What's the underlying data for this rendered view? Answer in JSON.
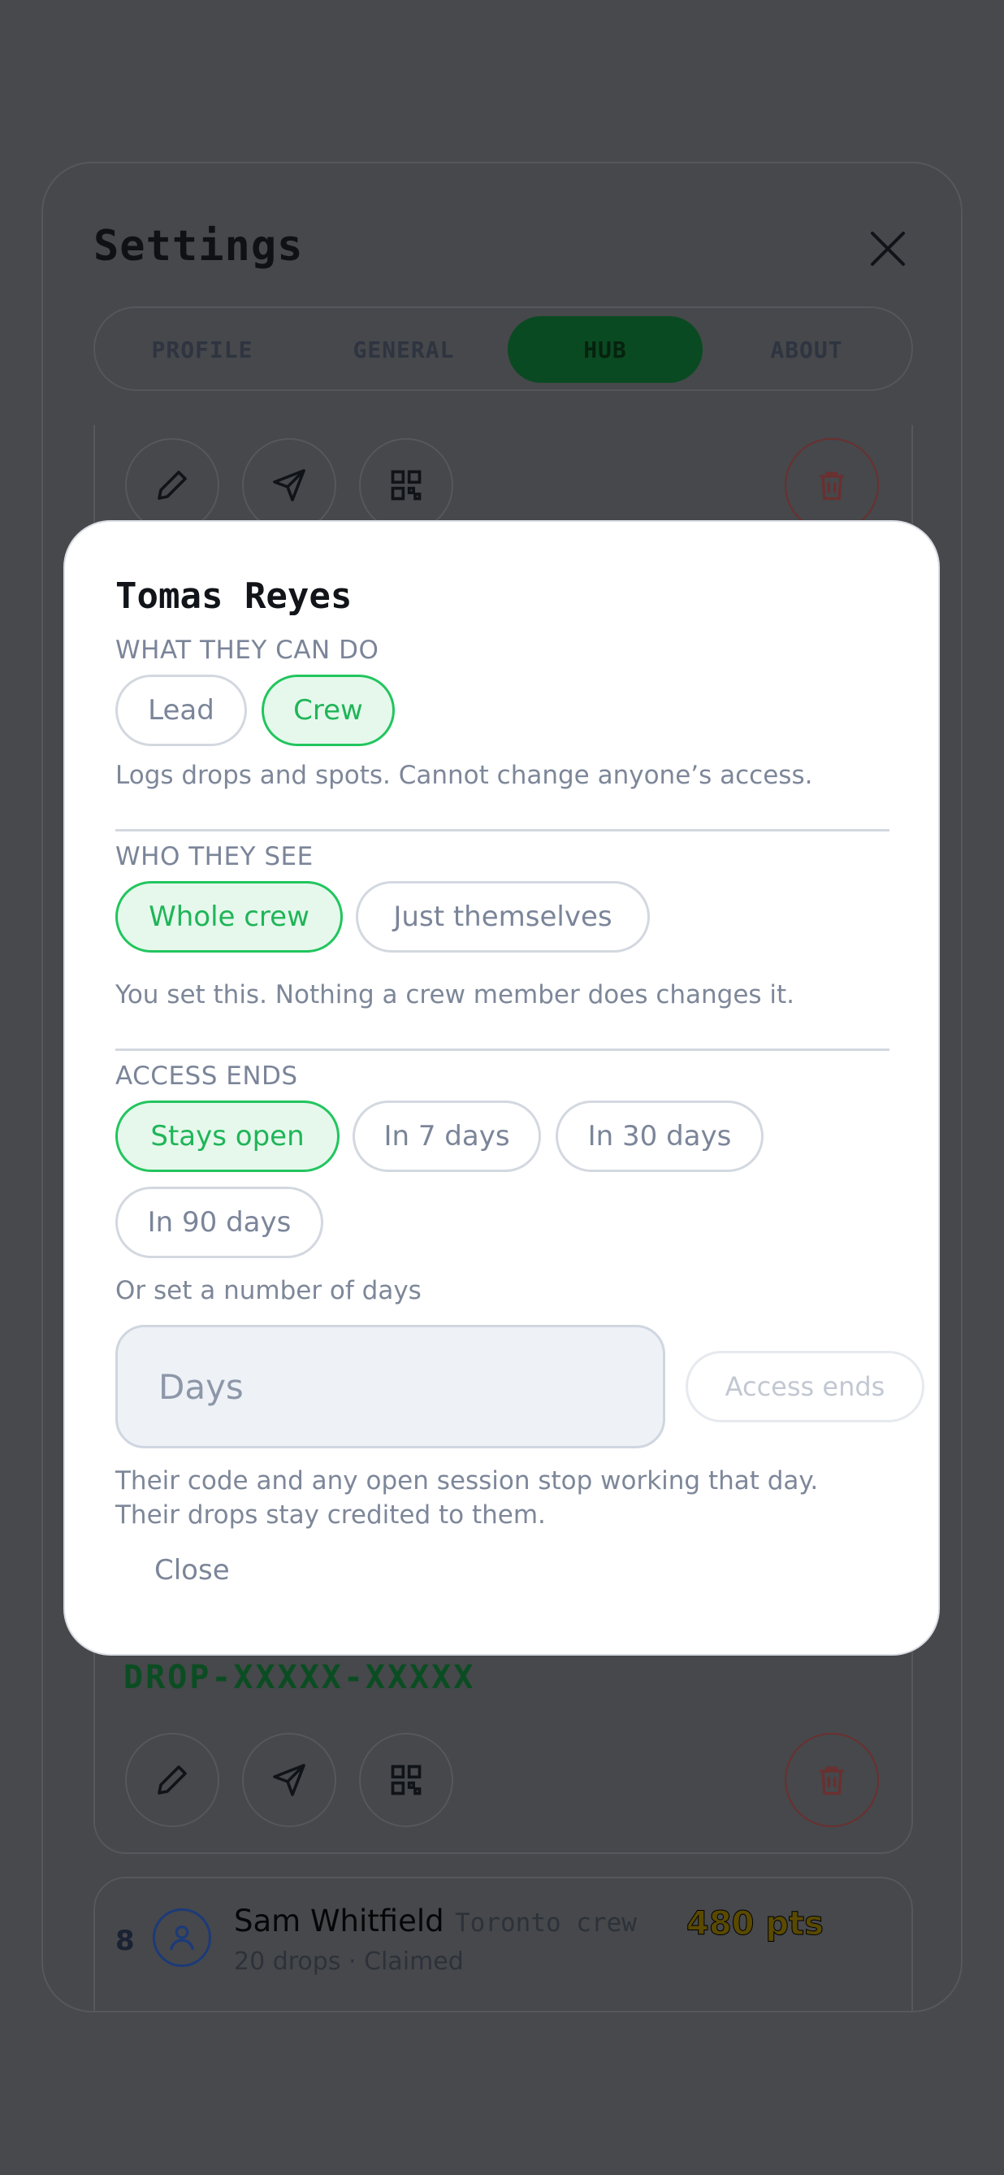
{
  "settings": {
    "title": "Settings",
    "tabs": [
      {
        "label": "PROFILE",
        "active": false
      },
      {
        "label": "GENERAL",
        "active": false
      },
      {
        "label": "HUB",
        "active": true
      },
      {
        "label": "ABOUT",
        "active": false
      }
    ]
  },
  "card": {
    "code": "DROP-XXXXX-XXXXX"
  },
  "leaderboard_row": {
    "rank": "8",
    "name": "Sam Whitfield",
    "team": "Toronto crew",
    "meta": "20 drops · Claimed",
    "points": "480 pts"
  },
  "modal": {
    "title": "Tomas Reyes",
    "role": {
      "label": "WHAT THEY CAN DO",
      "options": [
        "Lead",
        "Crew"
      ],
      "selected": "Crew",
      "help": "Logs drops and spots. Cannot change anyone’s access."
    },
    "visibility": {
      "label": "WHO THEY SEE",
      "options": [
        "Whole crew",
        "Just themselves"
      ],
      "selected": "Whole crew",
      "help": "You set this. Nothing a crew member does changes it."
    },
    "access": {
      "label": "ACCESS ENDS",
      "options": [
        "Stays open",
        "In 7 days",
        "In 30 days",
        "In 90 days"
      ],
      "selected": "Stays open",
      "custom_label": "Or set a number of days",
      "days_placeholder": "Days",
      "days_value": "",
      "apply_button": "Access ends",
      "help_line1": "Their code and any open session stop working that day.",
      "help_line2": "Their drops stay credited to them."
    },
    "close_label": "Close"
  },
  "colors": {
    "accent": "#22c55e",
    "accent_bg": "#e6f8ec",
    "overlay": "#47494c",
    "danger": "#6b2f2f"
  }
}
